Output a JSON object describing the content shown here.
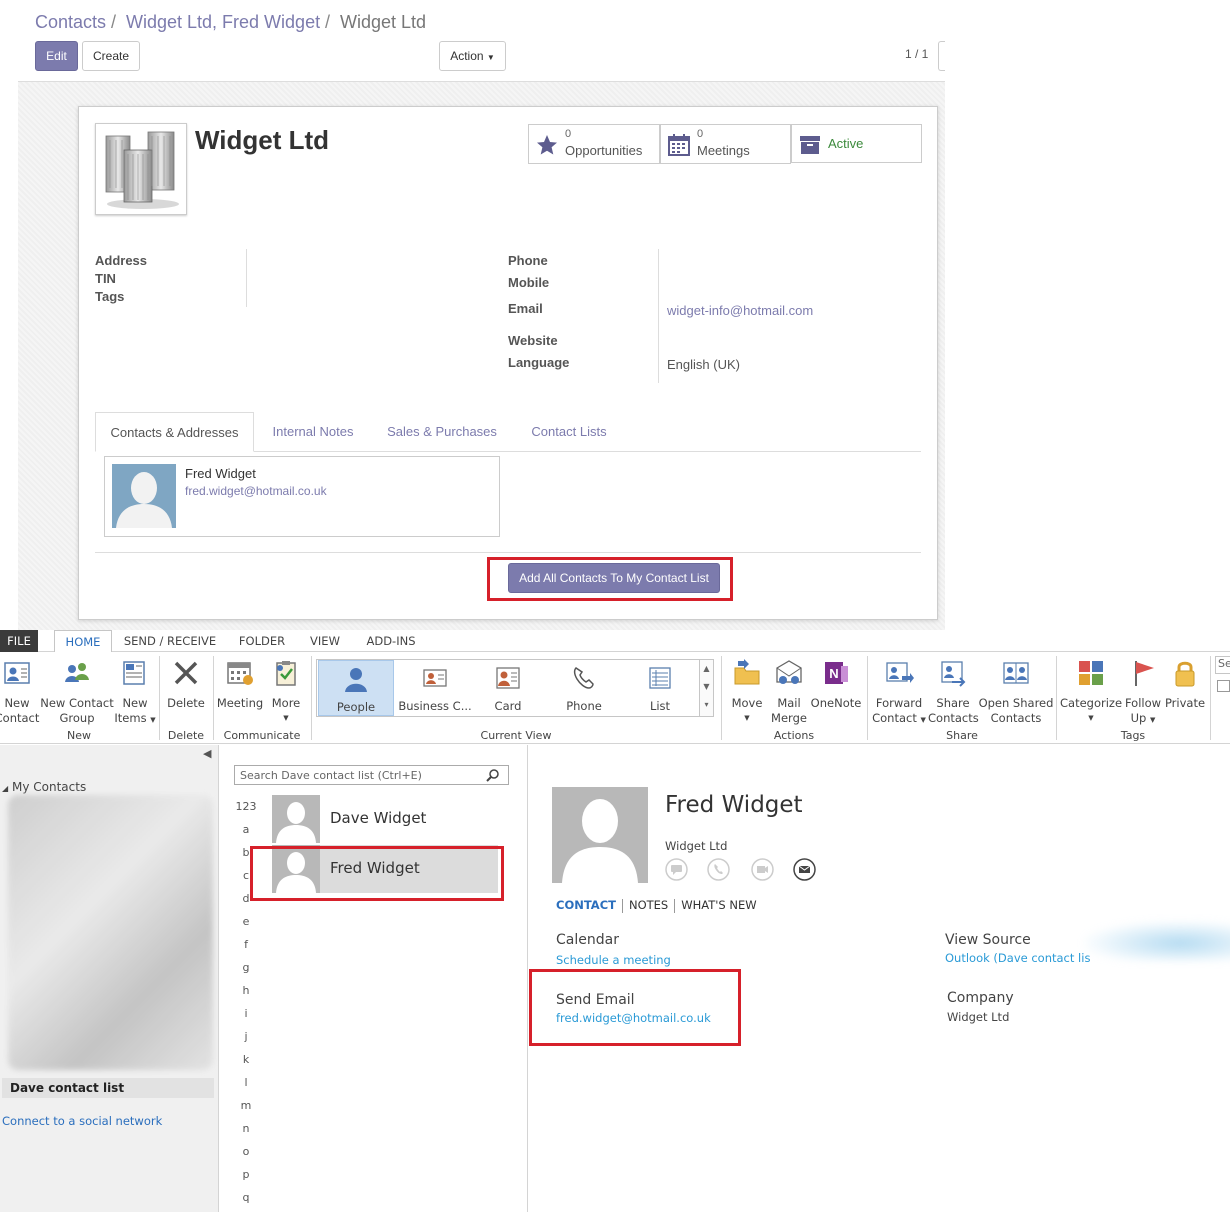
{
  "odoo": {
    "breadcrumb": {
      "part1": "Contacts",
      "part2": "Widget Ltd, Fred Widget",
      "current": "Widget Ltd",
      "sep": "/"
    },
    "buttons": {
      "edit": "Edit",
      "create": "Create",
      "action": "Action"
    },
    "pager": "1 / 1",
    "company_name": "Widget Ltd",
    "smart_buttons": {
      "opportunities": {
        "count": "0",
        "label": "Opportunities"
      },
      "meetings": {
        "count": "0",
        "label": "Meetings"
      },
      "active": {
        "label": "Active"
      }
    },
    "left_fields": {
      "address": "Address",
      "tin": "TIN",
      "tags": "Tags"
    },
    "right_fields": {
      "phone": "Phone",
      "mobile": "Mobile",
      "email": "Email",
      "website": "Website",
      "language": "Language",
      "email_value": "widget-info@hotmail.com",
      "language_value": "English (UK)"
    },
    "tabs": [
      "Contacts & Addresses",
      "Internal Notes",
      "Sales & Purchases",
      "Contact Lists"
    ],
    "contact_card": {
      "name": "Fred Widget",
      "email": "fred.widget@hotmail.co.uk"
    },
    "add_all_button": "Add All Contacts To My Contact List",
    "colors": {
      "brand": "#7c7bad",
      "highlight": "#d6202a"
    }
  },
  "outlook": {
    "ribbon_tabs": [
      "FILE",
      "HOME",
      "SEND / RECEIVE",
      "FOLDER",
      "VIEW",
      "ADD-INS"
    ],
    "ribbon": {
      "new_contact": [
        "New",
        "Contact"
      ],
      "new_contact_group": [
        "New Contact",
        "Group"
      ],
      "new_items": [
        "New",
        "Items"
      ],
      "delete": "Delete",
      "meeting": "Meeting",
      "more": "More",
      "current_view": [
        "People",
        "Business C...",
        "Card",
        "Phone",
        "List"
      ],
      "move": "Move",
      "mail_merge": [
        "Mail",
        "Merge"
      ],
      "onenote": "OneNote",
      "forward_contact": [
        "Forward",
        "Contact"
      ],
      "share_contacts": [
        "Share",
        "Contacts"
      ],
      "open_shared": [
        "Open Shared",
        "Contacts"
      ],
      "categorize": "Categorize",
      "follow_up": [
        "Follow",
        "Up"
      ],
      "private": "Private",
      "search_partial": "Se",
      "groups": {
        "new": "New",
        "delete": "Delete",
        "communicate": "Communicate",
        "current_view": "Current View",
        "actions": "Actions",
        "share": "Share",
        "tags": "Tags"
      }
    },
    "nav": {
      "my_contacts": "My Contacts",
      "dave_contact_list": "Dave contact list",
      "connect_social": "Connect to a social network"
    },
    "search": {
      "placeholder": "Search Dave contact list (Ctrl+E)"
    },
    "alphabet": [
      "123",
      "a",
      "b",
      "c",
      "d",
      "e",
      "f",
      "g",
      "h",
      "i",
      "j",
      "k",
      "l",
      "m",
      "n",
      "o",
      "p",
      "q"
    ],
    "people": [
      {
        "name": "Dave Widget"
      },
      {
        "name": "Fred Widget"
      }
    ],
    "reading": {
      "name": "Fred Widget",
      "company": "Widget Ltd",
      "tabs": [
        "CONTACT",
        "NOTES",
        "WHAT'S NEW"
      ],
      "calendar_heading": "Calendar",
      "calendar_link": "Schedule a meeting",
      "send_email_heading": "Send Email",
      "send_email_value": "fred.widget@hotmail.co.uk",
      "view_source_heading": "View Source",
      "view_source_value": "Outlook (Dave contact lis",
      "company_heading": "Company",
      "company_value": "Widget Ltd"
    },
    "colors": {
      "link": "#2a6ebd",
      "selected": "#cde0f3"
    }
  }
}
